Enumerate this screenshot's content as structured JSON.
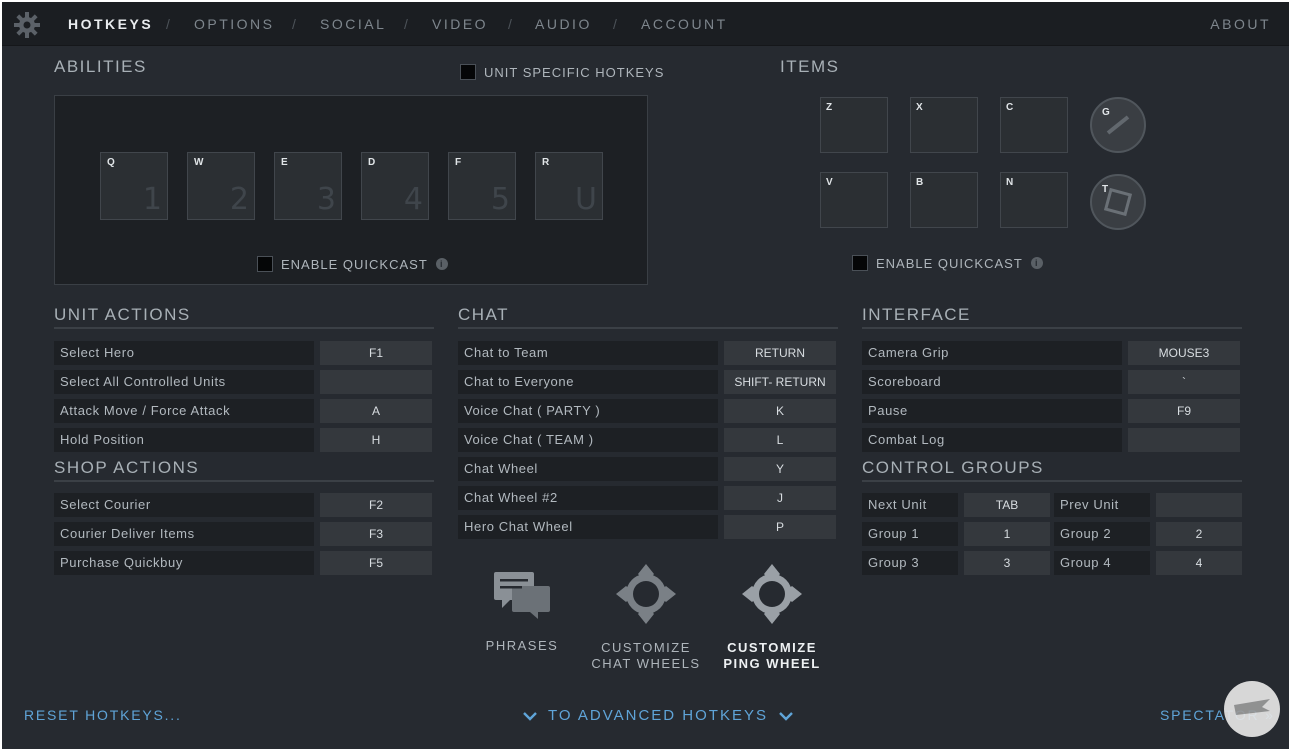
{
  "nav": {
    "tabs": [
      "HOTKEYS",
      "OPTIONS",
      "SOCIAL",
      "VIDEO",
      "AUDIO",
      "ACCOUNT"
    ],
    "active": "HOTKEYS",
    "about": "ABOUT"
  },
  "abilities": {
    "title": "ABILITIES",
    "unit_specific": "UNIT SPECIFIC HOTKEYS",
    "slots": [
      {
        "key": "Q",
        "num": "1"
      },
      {
        "key": "W",
        "num": "2"
      },
      {
        "key": "E",
        "num": "3"
      },
      {
        "key": "D",
        "num": "4"
      },
      {
        "key": "F",
        "num": "5"
      },
      {
        "key": "R",
        "num": "U"
      }
    ],
    "quickcast": "ENABLE QUICKCAST"
  },
  "items": {
    "title": "ITEMS",
    "row1": [
      "Z",
      "X",
      "C"
    ],
    "row2": [
      "V",
      "B",
      "N"
    ],
    "round1": "G",
    "round2": "T",
    "quickcast": "ENABLE QUICKCAST"
  },
  "unit_actions": {
    "title": "UNIT ACTIONS",
    "rows": [
      {
        "label": "Select Hero",
        "key": "F1"
      },
      {
        "label": "Select All Controlled Units",
        "key": ""
      },
      {
        "label": "Attack Move / Force Attack",
        "key": "A"
      },
      {
        "label": "Hold Position",
        "key": "H"
      }
    ]
  },
  "shop_actions": {
    "title": "SHOP ACTIONS",
    "rows": [
      {
        "label": "Select Courier",
        "key": "F2"
      },
      {
        "label": "Courier Deliver Items",
        "key": "F3"
      },
      {
        "label": "Purchase Quickbuy",
        "key": "F5"
      }
    ]
  },
  "chat": {
    "title": "CHAT",
    "rows": [
      {
        "label": "Chat to Team",
        "key": "RETURN"
      },
      {
        "label": "Chat to Everyone",
        "key": "SHIFT- RETURN"
      },
      {
        "label": "Voice Chat ( PARTY )",
        "key": "K"
      },
      {
        "label": "Voice Chat ( TEAM )",
        "key": "L"
      },
      {
        "label": "Chat Wheel",
        "key": "Y"
      },
      {
        "label": "Chat Wheel #2",
        "key": "J"
      },
      {
        "label": "Hero Chat Wheel",
        "key": "P"
      }
    ]
  },
  "interface": {
    "title": "INTERFACE",
    "rows": [
      {
        "label": "Camera Grip",
        "key": "MOUSE3"
      },
      {
        "label": "Scoreboard",
        "key": "`"
      },
      {
        "label": "Pause",
        "key": "F9"
      },
      {
        "label": "Combat Log",
        "key": ""
      }
    ]
  },
  "control_groups": {
    "title": "CONTROL GROUPS",
    "rows": [
      [
        {
          "label": "Next Unit",
          "key": "TAB"
        },
        {
          "label": "Prev Unit",
          "key": ""
        }
      ],
      [
        {
          "label": "Group 1",
          "key": "1"
        },
        {
          "label": "Group 2",
          "key": "2"
        }
      ],
      [
        {
          "label": "Group 3",
          "key": "3"
        },
        {
          "label": "Group 4",
          "key": "4"
        }
      ]
    ]
  },
  "buttons": {
    "phrases": "PHRASES",
    "chat_wheels_1": "CUSTOMIZE",
    "chat_wheels_2": "CHAT WHEELS",
    "ping_wheel_1": "CUSTOMIZE",
    "ping_wheel_2": "PING WHEEL"
  },
  "footer": {
    "reset": "RESET HOTKEYS...",
    "advanced": "TO ADVANCED HOTKEYS",
    "spectator": "SPECTATOR »"
  },
  "colors": {
    "accent": "#5fa4d8",
    "background": "#262a30",
    "panel": "#1d2024"
  }
}
